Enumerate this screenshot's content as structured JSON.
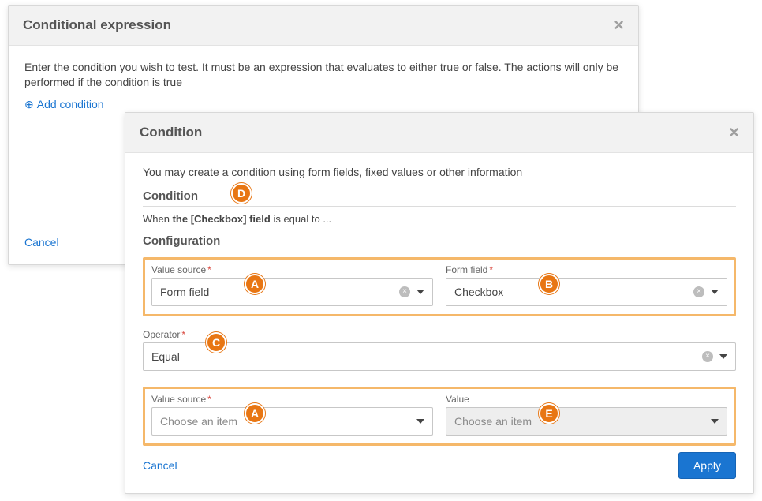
{
  "back_dialog": {
    "title": "Conditional expression",
    "description": "Enter the condition you wish to test. It must be an expression that evaluates to either true or false. The actions will only be performed if the condition is true",
    "add_condition_label": "Add condition",
    "cancel_label": "Cancel"
  },
  "front_dialog": {
    "title": "Condition",
    "intro": "You may create a condition using form fields, fixed values or other information",
    "section_condition": "Condition",
    "summary_prefix": "When ",
    "summary_field": "the [Checkbox] field",
    "summary_rest": " is equal to ...",
    "section_config": "Configuration",
    "labels": {
      "value_source": "Value source",
      "form_field": "Form field",
      "operator": "Operator",
      "value": "Value"
    },
    "fields": {
      "value_source_1": "Form field",
      "form_field": "Checkbox",
      "operator": "Equal",
      "value_source_2_placeholder": "Choose an item",
      "value_placeholder": "Choose an item"
    },
    "cancel_label": "Cancel",
    "apply_label": "Apply"
  },
  "callouts": {
    "A": "A",
    "B": "B",
    "C": "C",
    "D": "D",
    "E": "E"
  },
  "colors": {
    "accent": "#1a75d1",
    "callout": "#e87613",
    "highlight_border": "#f5b86a",
    "required": "#d9463d"
  }
}
